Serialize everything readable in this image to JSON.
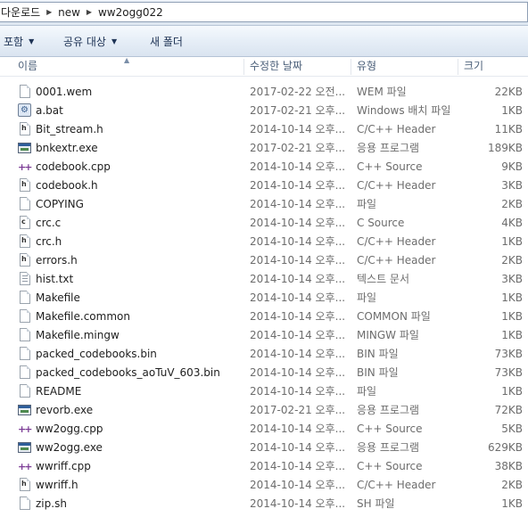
{
  "breadcrumb": [
    "다운로드",
    "new",
    "ww2ogg022"
  ],
  "toolbar": {
    "include_label": "포함",
    "share_label": "공유 대상",
    "new_folder_label": "새 폴더"
  },
  "columns": {
    "name": "이름",
    "date": "수정한 날짜",
    "type": "유형",
    "size": "크기"
  },
  "files": [
    {
      "name": "0001.wem",
      "date": "2017-02-22 오전...",
      "type": "WEM 파일",
      "size": "22KB",
      "icon": "blank-file-icon"
    },
    {
      "name": "a.bat",
      "date": "2017-02-21 오후...",
      "type": "Windows 배치 파일",
      "size": "1KB",
      "icon": "batch-file-icon"
    },
    {
      "name": "Bit_stream.h",
      "date": "2014-10-14 오후...",
      "type": "C/C++ Header",
      "size": "11KB",
      "icon": "header-file-icon"
    },
    {
      "name": "bnkextr.exe",
      "date": "2017-02-21 오후...",
      "type": "응용 프로그램",
      "size": "189KB",
      "icon": "application-icon"
    },
    {
      "name": "codebook.cpp",
      "date": "2014-10-14 오후...",
      "type": "C++ Source",
      "size": "9KB",
      "icon": "cpp-file-icon"
    },
    {
      "name": "codebook.h",
      "date": "2014-10-14 오후...",
      "type": "C/C++ Header",
      "size": "3KB",
      "icon": "header-file-icon"
    },
    {
      "name": "COPYING",
      "date": "2014-10-14 오후...",
      "type": "파일",
      "size": "2KB",
      "icon": "blank-file-icon"
    },
    {
      "name": "crc.c",
      "date": "2014-10-14 오후...",
      "type": "C Source",
      "size": "4KB",
      "icon": "c-file-icon"
    },
    {
      "name": "crc.h",
      "date": "2014-10-14 오후...",
      "type": "C/C++ Header",
      "size": "1KB",
      "icon": "header-file-icon"
    },
    {
      "name": "errors.h",
      "date": "2014-10-14 오후...",
      "type": "C/C++ Header",
      "size": "2KB",
      "icon": "header-file-icon"
    },
    {
      "name": "hist.txt",
      "date": "2014-10-14 오후...",
      "type": "텍스트 문서",
      "size": "3KB",
      "icon": "text-file-icon"
    },
    {
      "name": "Makefile",
      "date": "2014-10-14 오후...",
      "type": "파일",
      "size": "1KB",
      "icon": "blank-file-icon"
    },
    {
      "name": "Makefile.common",
      "date": "2014-10-14 오후...",
      "type": "COMMON 파일",
      "size": "1KB",
      "icon": "blank-file-icon"
    },
    {
      "name": "Makefile.mingw",
      "date": "2014-10-14 오후...",
      "type": "MINGW 파일",
      "size": "1KB",
      "icon": "blank-file-icon"
    },
    {
      "name": "packed_codebooks.bin",
      "date": "2014-10-14 오후...",
      "type": "BIN 파일",
      "size": "73KB",
      "icon": "blank-file-icon"
    },
    {
      "name": "packed_codebooks_aoTuV_603.bin",
      "date": "2014-10-14 오후...",
      "type": "BIN 파일",
      "size": "73KB",
      "icon": "blank-file-icon"
    },
    {
      "name": "README",
      "date": "2014-10-14 오후...",
      "type": "파일",
      "size": "1KB",
      "icon": "blank-file-icon"
    },
    {
      "name": "revorb.exe",
      "date": "2017-02-21 오후...",
      "type": "응용 프로그램",
      "size": "72KB",
      "icon": "application-icon"
    },
    {
      "name": "ww2ogg.cpp",
      "date": "2014-10-14 오후...",
      "type": "C++ Source",
      "size": "5KB",
      "icon": "cpp-file-icon"
    },
    {
      "name": "ww2ogg.exe",
      "date": "2014-10-14 오후...",
      "type": "응용 프로그램",
      "size": "629KB",
      "icon": "application-icon"
    },
    {
      "name": "wwriff.cpp",
      "date": "2014-10-14 오후...",
      "type": "C++ Source",
      "size": "38KB",
      "icon": "cpp-file-icon"
    },
    {
      "name": "wwriff.h",
      "date": "2014-10-14 오후...",
      "type": "C/C++ Header",
      "size": "2KB",
      "icon": "header-file-icon"
    },
    {
      "name": "zip.sh",
      "date": "2014-10-14 오후...",
      "type": "SH 파일",
      "size": "1KB",
      "icon": "blank-file-icon"
    }
  ]
}
